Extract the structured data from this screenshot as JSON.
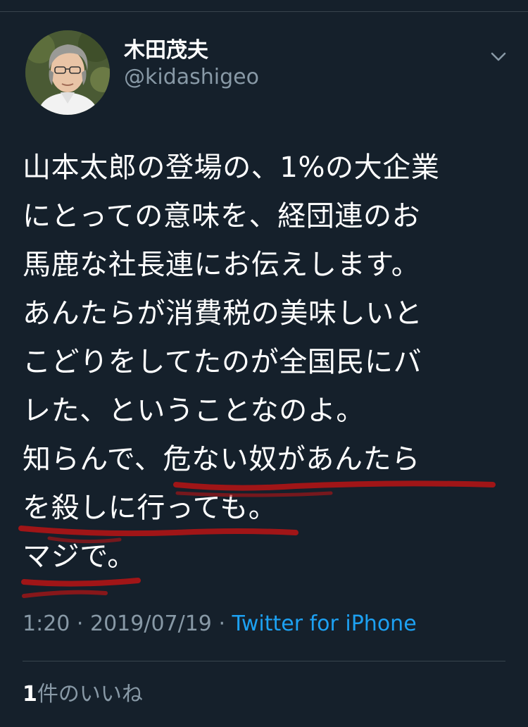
{
  "user": {
    "display_name": "木田茂夫",
    "handle": "@kidashigeo"
  },
  "tweet": {
    "lines": [
      "山本太郎の登場の、1%の大企業",
      "にとっての意味を、経団連のお",
      "馬鹿な社長連にお伝えします。",
      "あんたらが消費税の美味しいと",
      "こどりをしてたのが全国民にバ",
      "レた、ということなのよ。",
      "知らんで、危ない奴があんたら",
      "を殺しに行っても。",
      "マジで。"
    ]
  },
  "meta": {
    "time": "1:20",
    "separator_1": " · ",
    "date": "2019/07/19",
    "separator_2": " · ",
    "source": "Twitter for iPhone"
  },
  "likes": {
    "count": "1",
    "label": "件のいいね"
  },
  "icons": {
    "more": "chevron-down-icon",
    "avatar": "profile-photo"
  },
  "colors": {
    "background": "#15202b",
    "text": "#ffffff",
    "secondary": "#8899a6",
    "link": "#1da1f2",
    "divider": "#38444d",
    "annotation": "#b81414"
  }
}
